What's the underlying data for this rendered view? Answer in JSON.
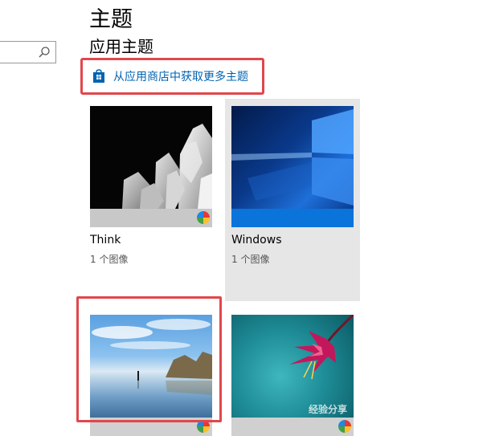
{
  "header": {
    "title": "主题"
  },
  "section": {
    "title": "应用主题"
  },
  "store_link": {
    "label": "从应用商店中获取更多主题"
  },
  "themes": [
    {
      "name": "Think",
      "count": "1 个图像"
    },
    {
      "name": "Windows",
      "count": "1 个图像"
    },
    {
      "name": "",
      "count": ""
    },
    {
      "name": "",
      "count": ""
    }
  ],
  "watermark": {
    "text": "经验分享"
  },
  "colors": {
    "accent": "#0063b1",
    "highlight": "#e0474c",
    "selected_bg": "#e6e6e6"
  }
}
